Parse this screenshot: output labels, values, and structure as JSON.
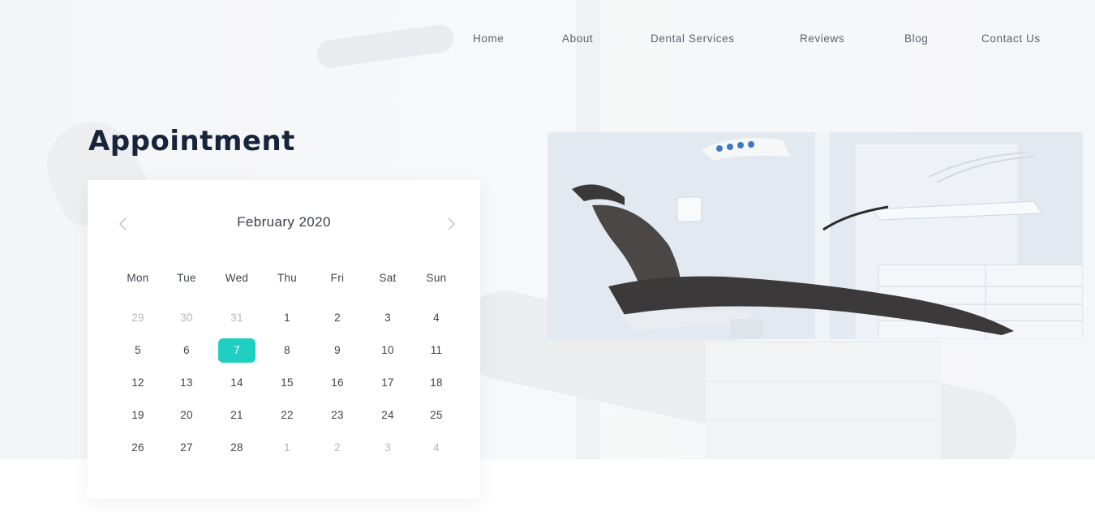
{
  "nav": {
    "items": [
      {
        "label": "Home",
        "name": "nav-home"
      },
      {
        "label": "About",
        "name": "nav-about"
      },
      {
        "label": "Dental Services",
        "name": "nav-dental-services"
      },
      {
        "label": "Reviews",
        "name": "nav-reviews"
      },
      {
        "label": "Blog",
        "name": "nav-blog"
      },
      {
        "label": "Contact Us",
        "name": "nav-contact-us"
      }
    ]
  },
  "page": {
    "title": "Appointment"
  },
  "calendar": {
    "month_label": "February 2020",
    "prev_icon": "chevron-left-icon",
    "next_icon": "chevron-right-icon",
    "weekdays": [
      "Mon",
      "Tue",
      "Wed",
      "Thu",
      "Fri",
      "Sat",
      "Sun"
    ],
    "weeks": [
      [
        {
          "d": "29",
          "m": true
        },
        {
          "d": "30",
          "m": true
        },
        {
          "d": "31",
          "m": true
        },
        {
          "d": "1"
        },
        {
          "d": "2"
        },
        {
          "d": "3"
        },
        {
          "d": "4"
        }
      ],
      [
        {
          "d": "5"
        },
        {
          "d": "6"
        },
        {
          "d": "7",
          "sel": true
        },
        {
          "d": "8"
        },
        {
          "d": "9"
        },
        {
          "d": "10"
        },
        {
          "d": "11"
        }
      ],
      [
        {
          "d": "12"
        },
        {
          "d": "13"
        },
        {
          "d": "14"
        },
        {
          "d": "15"
        },
        {
          "d": "16"
        },
        {
          "d": "17"
        },
        {
          "d": "18"
        }
      ],
      [
        {
          "d": "19"
        },
        {
          "d": "20"
        },
        {
          "d": "21"
        },
        {
          "d": "22"
        },
        {
          "d": "23"
        },
        {
          "d": "24"
        },
        {
          "d": "25"
        }
      ],
      [
        {
          "d": "26"
        },
        {
          "d": "27"
        },
        {
          "d": "28"
        },
        {
          "d": "1",
          "m": true
        },
        {
          "d": "2",
          "m": true
        },
        {
          "d": "3",
          "m": true
        },
        {
          "d": "4",
          "m": true
        }
      ]
    ],
    "selected_color": "#1fcfc1"
  },
  "colors": {
    "title": "#17243b",
    "nav_text": "#5c6370",
    "accent": "#1fcfc1"
  }
}
